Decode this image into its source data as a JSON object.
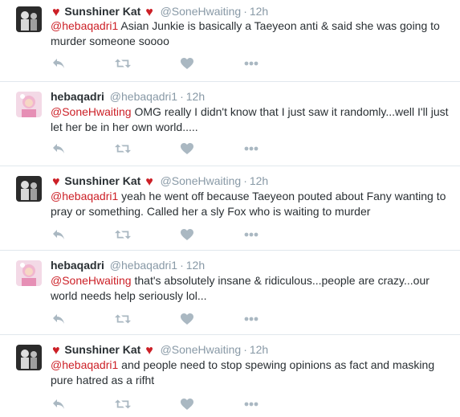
{
  "colors": {
    "mention": "#cc1f26",
    "heart_emoji": "#cc1f26",
    "meta_text": "#8899a6",
    "action_icon": "#aab8c2",
    "divider": "#e1e8ed"
  },
  "tweets": [
    {
      "name": "Sunshiner Kat",
      "heart_emoji": "♥",
      "handle": "@SoneHwaiting",
      "dot": "·",
      "time": "12h",
      "mention": "@hebaqadri1",
      "text": " Asian Junkie is basically a Taeyeon anti & said she was going to murder someone soooo",
      "actions": [
        "reply-icon",
        "retweet-icon",
        "like-icon",
        "more-icon"
      ]
    },
    {
      "name": "hebaqadri",
      "handle": "@hebaqadri1",
      "dot": "·",
      "time": "12h",
      "mention": "@SoneHwaiting",
      "text": " OMG really I didn't know that I just saw it randomly...well I'll just let her be in her own world.....",
      "actions": [
        "reply-icon",
        "retweet-icon",
        "like-icon",
        "more-icon"
      ]
    },
    {
      "name": "Sunshiner Kat",
      "heart_emoji": "♥",
      "handle": "@SoneHwaiting",
      "dot": "·",
      "time": "12h",
      "mention": "@hebaqadri1",
      "text": " yeah he went off because Taeyeon pouted about Fany wanting to pray or something. Called her a sly Fox who is waiting to murder",
      "actions": [
        "reply-icon",
        "retweet-icon",
        "like-icon",
        "more-icon"
      ]
    },
    {
      "name": "hebaqadri",
      "handle": "@hebaqadri1",
      "dot": "·",
      "time": "12h",
      "mention": "@SoneHwaiting",
      "text": " that's absolutely insane & ridiculous...people are crazy...our world needs help seriously lol...",
      "actions": [
        "reply-icon",
        "retweet-icon",
        "like-icon",
        "more-icon"
      ]
    },
    {
      "name": "Sunshiner Kat",
      "heart_emoji": "♥",
      "handle": "@SoneHwaiting",
      "dot": "·",
      "time": "12h",
      "mention": "@hebaqadri1",
      "text": " and people need to stop spewing opinions as fact and masking pure hatred as a rifht",
      "actions": [
        "reply-icon",
        "retweet-icon",
        "like-icon",
        "more-icon"
      ]
    }
  ]
}
